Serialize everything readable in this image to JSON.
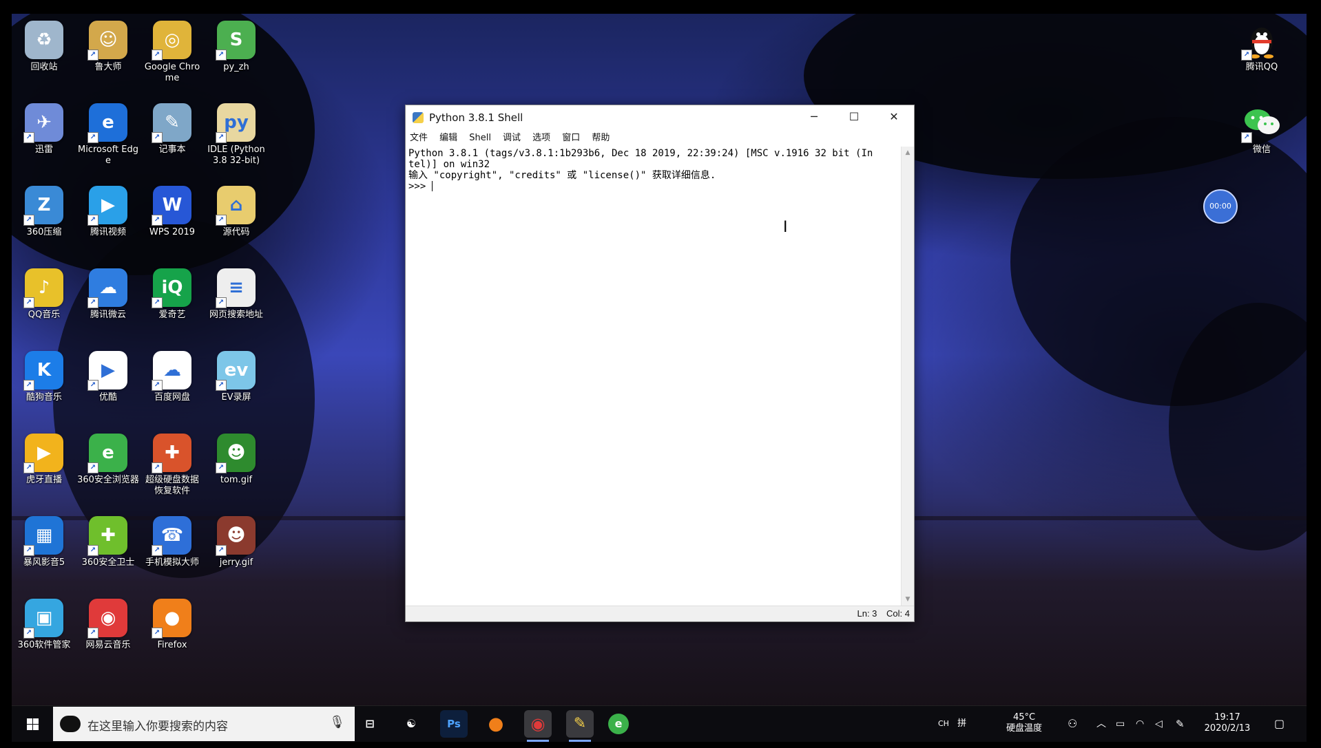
{
  "desktop": {
    "icons": [
      {
        "label": "回收站",
        "icon": "recycle-bin-icon",
        "color": "#9fb6cc"
      },
      {
        "label": "鲁大师",
        "icon": "ludashi-icon",
        "color": "#d3a84b"
      },
      {
        "label": "Google Chrome",
        "icon": "chrome-icon",
        "color": "#e0b43a"
      },
      {
        "label": "py_zh",
        "icon": "snake-icon",
        "color": "#4caf50"
      },
      {
        "label": "迅雷",
        "icon": "xunlei-icon",
        "color": "#6f8bd8"
      },
      {
        "label": "Microsoft Edge",
        "icon": "edge-icon",
        "color": "#1e6fd9"
      },
      {
        "label": "记事本",
        "icon": "notepad-icon",
        "color": "#7fa7c8"
      },
      {
        "label": "IDLE (Python 3.8 32-bit)",
        "icon": "idle-icon",
        "color": "#e8d7a0"
      },
      {
        "label": "360压缩",
        "icon": "360zip-icon",
        "color": "#3a8ad6"
      },
      {
        "label": "腾讯视频",
        "icon": "tencent-video-icon",
        "color": "#2aa0e8"
      },
      {
        "label": "WPS 2019",
        "icon": "wps-icon",
        "color": "#2757d6"
      },
      {
        "label": "源代码",
        "icon": "folder-icon",
        "color": "#e8cc6e"
      },
      {
        "label": "QQ音乐",
        "icon": "qqmusic-icon",
        "color": "#e8c12a"
      },
      {
        "label": "腾讯微云",
        "icon": "weiyun-icon",
        "color": "#2f7de0"
      },
      {
        "label": "爱奇艺",
        "icon": "iqiyi-icon",
        "color": "#16a34a"
      },
      {
        "label": "网页搜索地址",
        "icon": "document-icon",
        "color": "#eeeeee"
      },
      {
        "label": "酷狗音乐",
        "icon": "kugou-icon",
        "color": "#1c7de8"
      },
      {
        "label": "优酷",
        "icon": "youku-icon",
        "color": "#ffffff"
      },
      {
        "label": "百度网盘",
        "icon": "baidu-pan-icon",
        "color": "#ffffff"
      },
      {
        "label": "EV录屏",
        "icon": "ev-record-icon",
        "color": "#7dc6e8"
      },
      {
        "label": "虎牙直播",
        "icon": "huya-icon",
        "color": "#f2b31c"
      },
      {
        "label": "360安全浏览器",
        "icon": "360browser-icon",
        "color": "#3bb14a"
      },
      {
        "label": "超级硬盘数据恢复软件",
        "icon": "disk-recovery-icon",
        "color": "#d9532b"
      },
      {
        "label": "tom.gif",
        "icon": "gif-icon",
        "color": "#2e8b2e"
      },
      {
        "label": "暴风影音5",
        "icon": "baofeng-icon",
        "color": "#1f74d6"
      },
      {
        "label": "360安全卫士",
        "icon": "360safe-icon",
        "color": "#6fbf2c"
      },
      {
        "label": "手机模拟大师",
        "icon": "phone-emulator-icon",
        "color": "#2e6fd8"
      },
      {
        "label": "jerry.gif",
        "icon": "gif-icon",
        "color": "#8b3a2e"
      },
      {
        "label": "360软件管家",
        "icon": "360software-icon",
        "color": "#35a6e0"
      },
      {
        "label": "网易云音乐",
        "icon": "netease-music-icon",
        "color": "#e03a3a"
      },
      {
        "label": "Firefox",
        "icon": "firefox-icon",
        "color": "#f07f1a"
      }
    ],
    "right_icons": [
      {
        "label": "腾讯QQ",
        "icon": "qq-icon"
      },
      {
        "label": "微信",
        "icon": "wechat-icon"
      }
    ],
    "timer": "00:00"
  },
  "window": {
    "title": "Python 3.8.1 Shell",
    "menu": [
      "文件",
      "编辑",
      "Shell",
      "调试",
      "选项",
      "窗口",
      "帮助"
    ],
    "lines": [
      "Python 3.8.1 (tags/v3.8.1:1b293b6, Dec 18 2019, 22:39:24) [MSC v.1916 32 bit (In",
      "tel)] on win32",
      "输入 \"copyright\", \"credits\" 或 \"license()\" 获取详细信息.",
      ">>> "
    ],
    "status": {
      "ln": "Ln: 3",
      "col": "Col: 4"
    }
  },
  "taskbar": {
    "search_placeholder": "在这里输入你要搜索的内容",
    "apps": [
      {
        "name": "task-view",
        "glyph": "⊟"
      },
      {
        "name": "steam-like",
        "glyph": "☯"
      },
      {
        "name": "photoshop",
        "glyph": "Ps"
      },
      {
        "name": "firefox",
        "glyph": "●"
      },
      {
        "name": "netease-music",
        "glyph": "◉"
      },
      {
        "name": "idle",
        "glyph": "✎"
      },
      {
        "name": "360browser",
        "glyph": "e"
      }
    ],
    "tray": {
      "ime": "CH",
      "ime2": "拼",
      "temp": "45°C",
      "temp_label": "硬盘温度",
      "time": "19:17",
      "date": "2020/2/13"
    }
  }
}
